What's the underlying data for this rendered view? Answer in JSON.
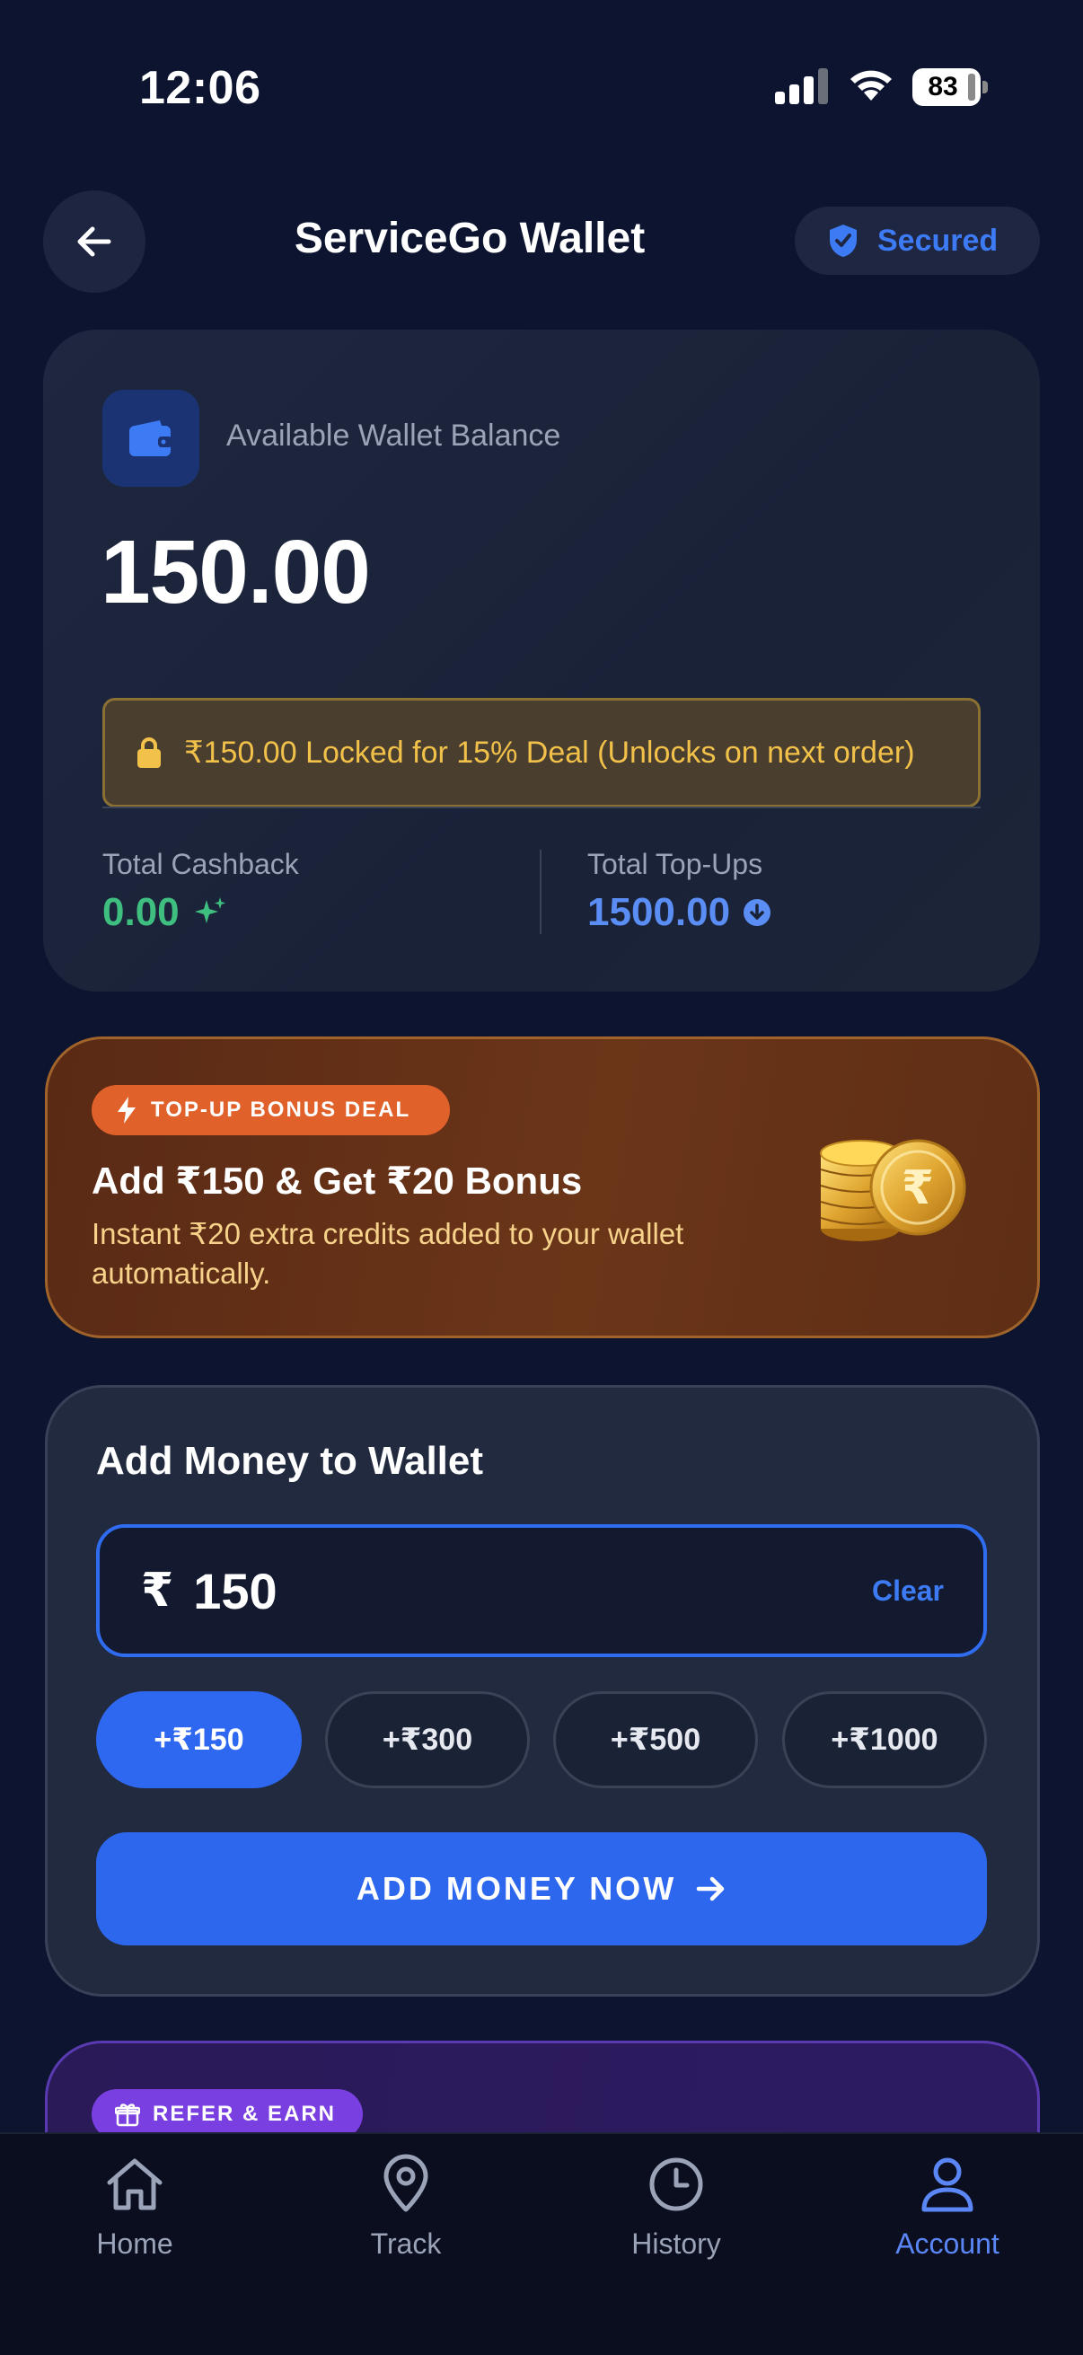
{
  "status_bar": {
    "time": "12:06",
    "battery": "83"
  },
  "header": {
    "title": "ServiceGo Wallet",
    "secured_label": "Secured"
  },
  "balance": {
    "label": "Available Wallet Balance",
    "amount": "150.00",
    "locked_notice": "₹150.00 Locked for 15% Deal (Unlocks on next order)",
    "cashback_label": "Total Cashback",
    "cashback_value": "0.00",
    "topups_label": "Total Top-Ups",
    "topups_value": "1500.00"
  },
  "bonus": {
    "badge": "TOP-UP BONUS DEAL",
    "title": "Add ₹150 & Get ₹20 Bonus",
    "description": "Instant ₹20 extra credits added to your wallet automatically."
  },
  "add_money": {
    "title": "Add Money to Wallet",
    "currency_symbol": "₹",
    "amount_value": "150",
    "clear_label": "Clear",
    "chips": [
      "+₹150",
      "+₹300",
      "+₹500",
      "+₹1000"
    ],
    "selected_chip": "+₹150",
    "button_label": "ADD MONEY NOW"
  },
  "refer": {
    "badge": "REFER & EARN"
  },
  "nav": {
    "items": [
      {
        "label": "Home",
        "icon": "home-icon"
      },
      {
        "label": "Track",
        "icon": "location-pin-icon"
      },
      {
        "label": "History",
        "icon": "clock-icon"
      },
      {
        "label": "Account",
        "icon": "user-icon"
      }
    ],
    "active": "Account"
  },
  "colors": {
    "background": "#0d1430",
    "accent_blue": "#2f68f0",
    "cashback_green": "#3fbf7f",
    "topups_blue": "#5b8ef5",
    "lock_amber": "#f2c14a",
    "bonus_orange": "#e0622a",
    "refer_purple": "#7a3fe0"
  }
}
